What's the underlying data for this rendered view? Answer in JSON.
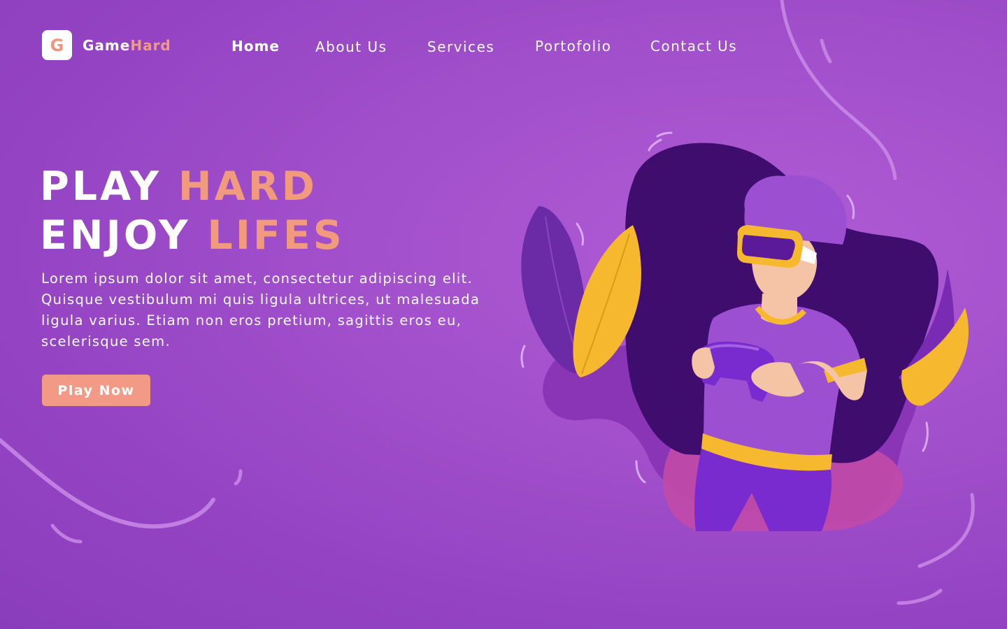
{
  "brand": {
    "logo_letter": "G",
    "name_part1": "Game",
    "name_part2": "Hard",
    "accent_color": "#f29a7e"
  },
  "nav": {
    "items": [
      {
        "label": "Home",
        "active": true
      },
      {
        "label": "About Us",
        "active": false
      },
      {
        "label": "Services",
        "active": false
      },
      {
        "label": "Portofolio",
        "active": false
      },
      {
        "label": "Contact Us",
        "active": false
      }
    ]
  },
  "hero": {
    "line1_white": "PLAY ",
    "line1_accent": "HARD",
    "line2_white": "ENJOY ",
    "line2_accent": "LIFES",
    "description": "Lorem ipsum dolor sit amet, consectetur adipiscing elit. Quisque vestibulum mi quis ligula ultrices, ut malesuada ligula varius. Etiam non eros pretium, sagittis eros eu, scelerisque sem.",
    "cta_label": "Play Now"
  },
  "colors": {
    "background": "#9f4ccb",
    "accent": "#f29a7e",
    "button": "#f29a86",
    "yellow": "#f5b82e",
    "deep_purple": "#3f0d6e"
  },
  "illustration": {
    "icon": "vr-gamer-illustration"
  }
}
